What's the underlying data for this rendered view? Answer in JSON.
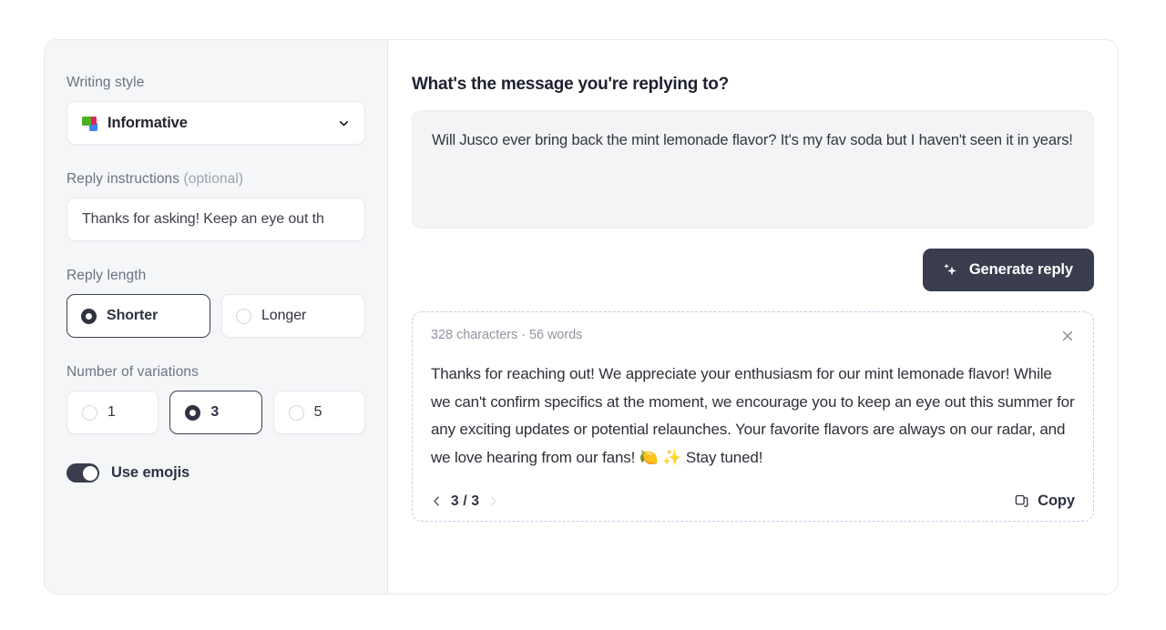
{
  "left_panel": {
    "writing_style": {
      "label": "Writing style",
      "value": "Informative",
      "icon": "layers-color-icon",
      "chevron": "chevron-down-icon"
    },
    "reply_instructions": {
      "label": "Reply instructions ",
      "label_optional": "(optional)",
      "value": "Thanks for asking! Keep an eye out th",
      "placeholder": "Add instructions for your reply"
    },
    "reply_length": {
      "label": "Reply length",
      "options": [
        {
          "label": "Shorter",
          "selected": true
        },
        {
          "label": "Longer",
          "selected": false
        }
      ]
    },
    "variations": {
      "label": "Number of variations",
      "options": [
        {
          "label": "1",
          "selected": false
        },
        {
          "label": "3",
          "selected": true
        },
        {
          "label": "5",
          "selected": false
        }
      ]
    },
    "use_emojis": {
      "label": "Use emojis",
      "enabled": true
    }
  },
  "right_panel": {
    "title": "What's the message you're replying to?",
    "message": "Will Jusco ever bring back the mint lemonade flavor? It's my fav soda but I haven't seen it in years!",
    "message_placeholder": "Paste the message you want to reply to",
    "generate_button": {
      "label": "Generate reply",
      "icon": "sparkles-icon"
    },
    "result": {
      "meta": "328 characters · 56 words",
      "close_icon": "close-icon",
      "body": "Thanks for reaching out! We appreciate your enthusiasm for our mint lemonade flavor! While we can't confirm specifics at the moment, we encourage you to keep an eye out this summer for any exciting updates or potential relaunches. Your favorite flavors are always on our radar, and we love hearing from our fans! 🍋 ✨ Stay tuned!",
      "pagination": {
        "prev_icon": "chevron-left-icon",
        "next_icon": "chevron-right-icon",
        "counter": "3 / 3",
        "current": 3,
        "total": 3
      },
      "copy": {
        "label": "Copy",
        "icon": "copy-icon"
      }
    }
  },
  "colors": {
    "accent_dark": "#3a3d4e",
    "panel_bg": "#f5f6f8",
    "message_bg": "#f3f4f6",
    "dashed_border": "#cfcbe8",
    "muted_text": "#9095a1"
  }
}
